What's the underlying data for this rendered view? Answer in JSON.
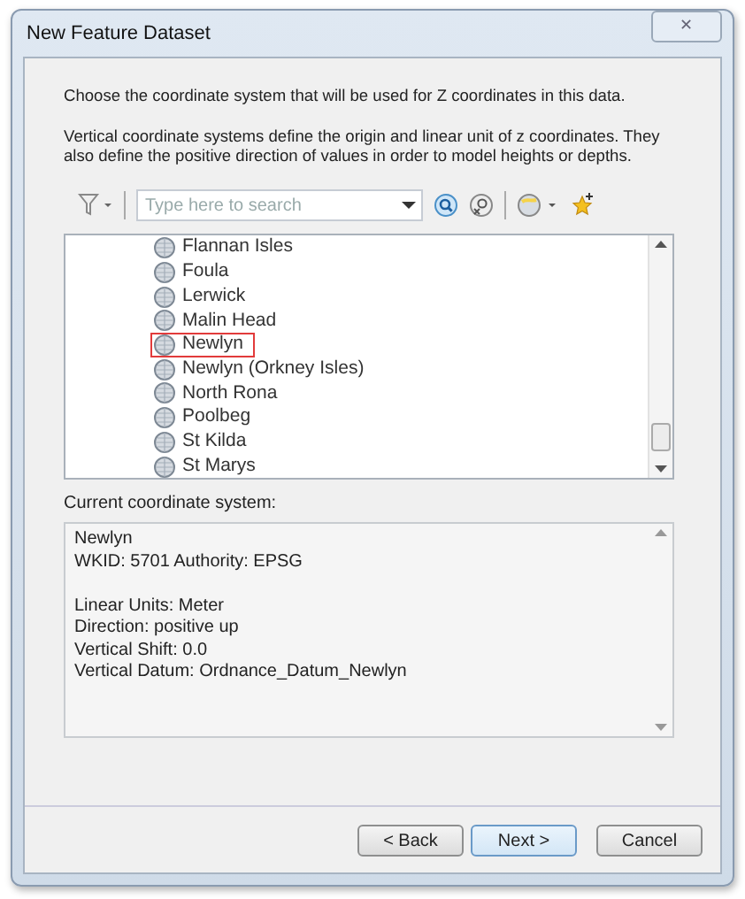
{
  "window": {
    "title": "New Feature Dataset",
    "close": "✕"
  },
  "intro": "Choose the coordinate system that will be used for Z coordinates in this data.",
  "description": "Vertical coordinate systems define the origin and linear unit of z coordinates. They also define the positive direction of values in order to model heights or depths.",
  "search": {
    "placeholder": "Type here to search"
  },
  "tree": {
    "items": [
      {
        "label": "Flannan Isles",
        "selected": false
      },
      {
        "label": "Foula",
        "selected": false
      },
      {
        "label": "Lerwick",
        "selected": false
      },
      {
        "label": "Malin Head",
        "selected": false
      },
      {
        "label": "Newlyn",
        "selected": true
      },
      {
        "label": "Newlyn (Orkney Isles)",
        "selected": false
      },
      {
        "label": "North Rona",
        "selected": false
      },
      {
        "label": "Poolbeg",
        "selected": false
      },
      {
        "label": "St Kilda",
        "selected": false
      },
      {
        "label": "St Marys",
        "selected": false
      }
    ]
  },
  "current": {
    "label": "Current coordinate system:",
    "paragraphs": [
      [
        "Newlyn",
        "WKID: 5701 Authority: EPSG"
      ],
      [
        "Linear Units: Meter",
        "Direction: positive up",
        "Vertical Shift: 0.0",
        "Vertical Datum: Ordnance_Datum_Newlyn"
      ]
    ]
  },
  "buttons": [
    {
      "label": "< Back",
      "kind": "back"
    },
    {
      "label": "Next >",
      "kind": "next"
    },
    {
      "label": "Cancel",
      "kind": "cancel"
    }
  ]
}
